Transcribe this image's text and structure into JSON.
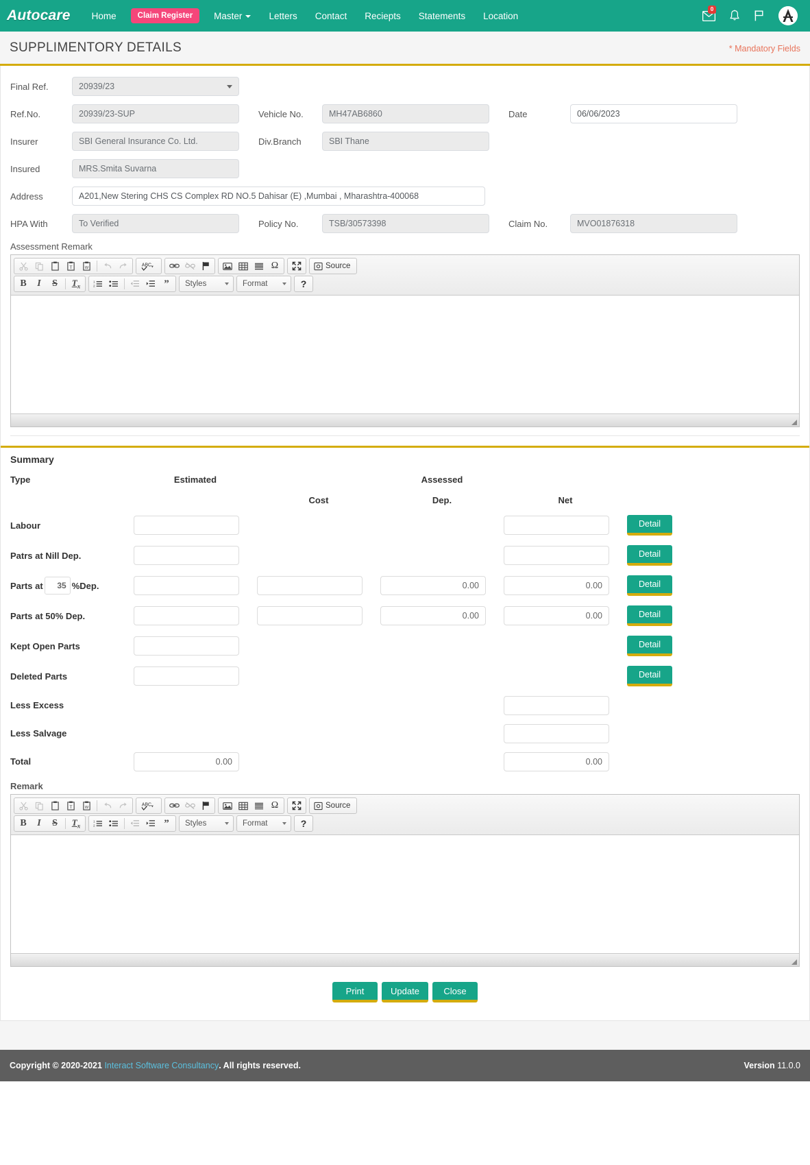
{
  "navbar": {
    "brand": "Autocare",
    "links": [
      {
        "label": "Home",
        "type": "link"
      },
      {
        "label": "Claim Register",
        "type": "pill"
      },
      {
        "label": "Master",
        "type": "dropdown"
      },
      {
        "label": "Letters",
        "type": "link"
      },
      {
        "label": "Contact",
        "type": "link"
      },
      {
        "label": "Reciepts",
        "type": "link"
      },
      {
        "label": "Statements",
        "type": "link"
      },
      {
        "label": "Location",
        "type": "link"
      }
    ],
    "icons": [
      "envelope-icon",
      "bell-icon",
      "flag-icon",
      "user-avatar"
    ],
    "mail_badge": "0",
    "brand_color": "#17a589",
    "pill_color": "#f5467a"
  },
  "page": {
    "title": "SUPPLIMENTORY DETAILS",
    "mandatory_note": "* Mandatory Fields",
    "accent_color": "#d4ac0d"
  },
  "form": {
    "final_ref": {
      "label": "Final Ref.",
      "value": "20939/23"
    },
    "ref_no": {
      "label": "Ref.No.",
      "value": "20939/23-SUP"
    },
    "vehicle_no": {
      "label": "Vehicle No.",
      "value": "MH47AB6860"
    },
    "date": {
      "label": "Date",
      "value": "06/06/2023"
    },
    "insurer": {
      "label": "Insurer",
      "value": "SBI General Insurance Co. Ltd."
    },
    "div_branch": {
      "label": "Div.Branch",
      "value": "SBI Thane"
    },
    "insured": {
      "label": "Insured",
      "value": "MRS.Smita Suvarna"
    },
    "address": {
      "label": "Address",
      "value": "A201,New Stering CHS CS Complex RD NO.5 Dahisar (E) ,Mumbai , Mharashtra-400068"
    },
    "hpa_with": {
      "label": "HPA With",
      "value": "To Verified"
    },
    "policy_no": {
      "label": "Policy No.",
      "value": "TSB/30573398"
    },
    "claim_no": {
      "label": "Claim No.",
      "value": "MVO01876318"
    }
  },
  "editor_assessment": {
    "label": "Assessment Remark",
    "content": "",
    "toolbar": {
      "source": "Source",
      "styles": "Styles",
      "format": "Format",
      "help": "?"
    }
  },
  "editor_remark": {
    "label": "Remark",
    "content": "",
    "toolbar": {
      "source": "Source",
      "styles": "Styles",
      "format": "Format",
      "help": "?"
    }
  },
  "summary": {
    "title": "Summary",
    "headers": {
      "type": "Type",
      "estimated": "Estimated",
      "assessed": "Assessed",
      "cost": "Cost",
      "dep": "Dep.",
      "net": "Net"
    },
    "detail_label": "Detail",
    "rows": [
      {
        "type": "Labour",
        "estimated": "",
        "cost": null,
        "dep": null,
        "net": "",
        "detail": true,
        "pct": null
      },
      {
        "type": "Patrs at Nill Dep.",
        "estimated": "",
        "cost": null,
        "dep": null,
        "net": "",
        "detail": true,
        "pct": null
      },
      {
        "type": "Parts at",
        "type_suffix": "%Dep.",
        "pct": "35",
        "estimated": "",
        "cost": "",
        "dep": "0.00",
        "net": "0.00",
        "detail": true
      },
      {
        "type": "Parts at 50% Dep.",
        "estimated": "",
        "cost": "",
        "dep": "0.00",
        "net": "0.00",
        "detail": true,
        "pct": null
      },
      {
        "type": "Kept Open Parts",
        "estimated": "",
        "cost": null,
        "dep": null,
        "net": null,
        "detail": true,
        "pct": null
      },
      {
        "type": "Deleted Parts",
        "estimated": "",
        "cost": null,
        "dep": null,
        "net": null,
        "detail": true,
        "pct": null
      },
      {
        "type": "Less Excess",
        "estimated": null,
        "cost": null,
        "dep": null,
        "net": "",
        "detail": false,
        "pct": null
      },
      {
        "type": "Less Salvage",
        "estimated": null,
        "cost": null,
        "dep": null,
        "net": "",
        "detail": false,
        "pct": null
      },
      {
        "type": "Total",
        "estimated": "0.00",
        "cost": null,
        "dep": null,
        "net": "0.00",
        "detail": false,
        "pct": null
      }
    ]
  },
  "actions": {
    "print": "Print",
    "update": "Update",
    "close": "Close"
  },
  "footer": {
    "copyright_prefix": "Copyright © 2020-2021",
    "company": "Interact Software Consultancy",
    "copyright_suffix": ". All rights reserved.",
    "version_label": "Version",
    "version_value": "11.0.0"
  }
}
